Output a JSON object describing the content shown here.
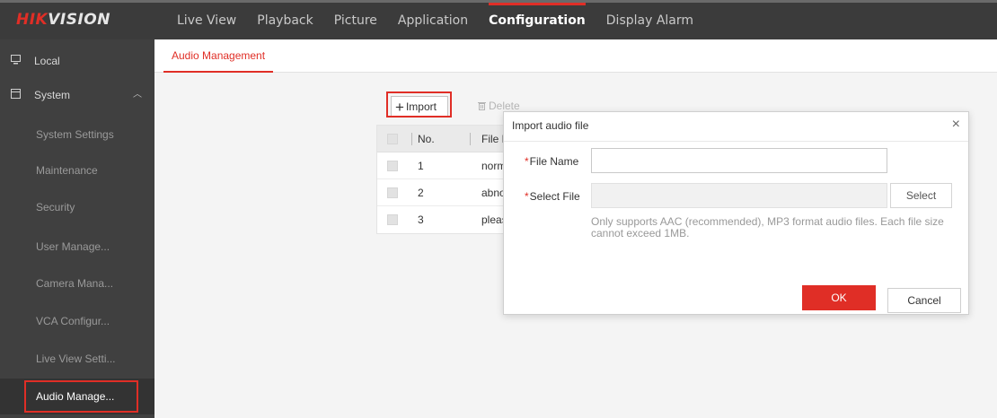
{
  "brand": {
    "part1": "HIK",
    "part2": "VISION"
  },
  "nav": [
    "Live View",
    "Playback",
    "Picture",
    "Application",
    "Configuration",
    "Display Alarm"
  ],
  "nav_active": "Configuration",
  "sidebar": {
    "local": "Local",
    "system": "System",
    "items": [
      "System Settings",
      "Maintenance",
      "Security",
      "User Manage...",
      "Camera Mana...",
      "VCA Configur...",
      "Live View Setti...",
      "Audio Manage..."
    ]
  },
  "tab": "Audio Management",
  "toolbar": {
    "import": "Import",
    "delete": "Delete"
  },
  "table": {
    "headers": [
      "No.",
      "File N"
    ],
    "rows": [
      {
        "no": "1",
        "name": "norm"
      },
      {
        "no": "2",
        "name": "abno"
      },
      {
        "no": "3",
        "name": "pleas"
      }
    ]
  },
  "modal": {
    "title": "Import audio file",
    "close": "×",
    "file_name_label": "File Name",
    "select_file_label": "Select File",
    "required_mark": "*",
    "select_button": "Select",
    "hint": "Only supports AAC (recommended), MP3 format audio files. Each file size cannot exceed 1MB.",
    "ok": "OK",
    "cancel": "Cancel"
  },
  "colors": {
    "accent": "#e02e26",
    "topbar": "#3b3b3b",
    "sidebar": "#404040"
  }
}
